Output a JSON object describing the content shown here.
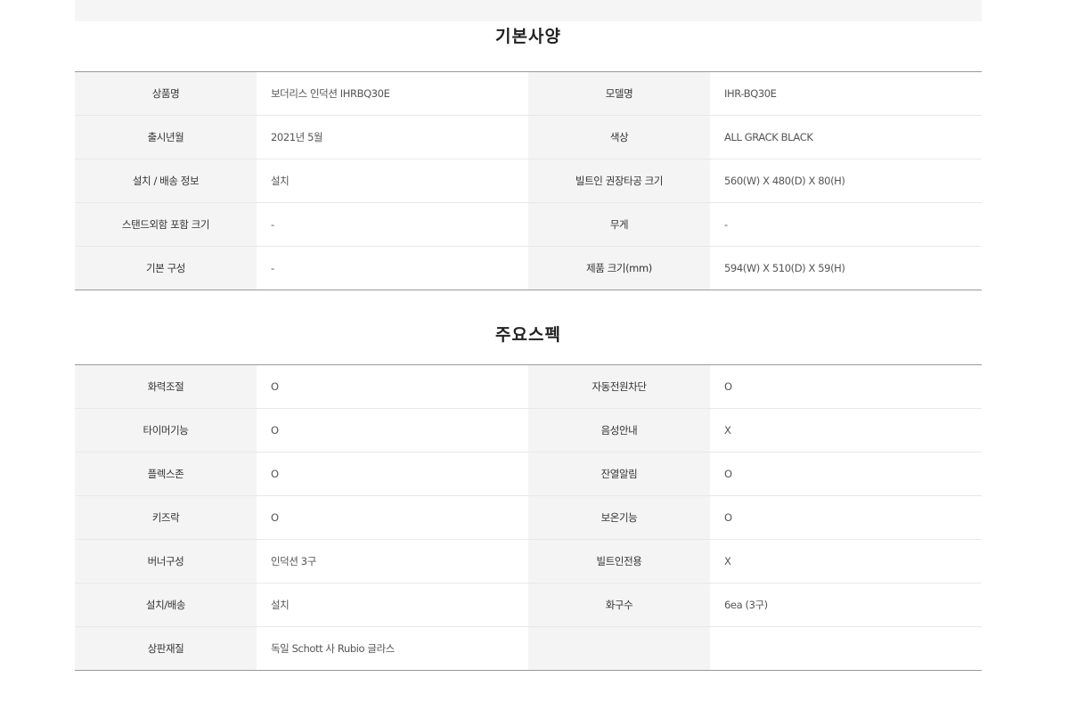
{
  "basic": {
    "title": "기본사양",
    "rows": [
      [
        {
          "label": "상품명",
          "value": "보더리스 인덕션 IHRBQ30E"
        },
        {
          "label": "모델명",
          "value": "IHR-BQ30E"
        }
      ],
      [
        {
          "label": "출시년월",
          "value": "2021년 5월"
        },
        {
          "label": "색상",
          "value": "ALL GRACK BLACK"
        }
      ],
      [
        {
          "label": "설치 / 배송 정보",
          "value": "설치"
        },
        {
          "label": "빌트인 권장타공 크기",
          "value": "560(W) X 480(D) X 80(H)"
        }
      ],
      [
        {
          "label": "스탠드외함 포함 크기",
          "value": "-"
        },
        {
          "label": "무게",
          "value": "-"
        }
      ],
      [
        {
          "label": "기본 구성",
          "value": "-"
        },
        {
          "label": "제품 크기(mm)",
          "value": "594(W) X 510(D) X 59(H)"
        }
      ]
    ]
  },
  "spec": {
    "title": "주요스펙",
    "rows": [
      [
        {
          "label": "화력조절",
          "value": "O"
        },
        {
          "label": "자동전원차단",
          "value": "O"
        }
      ],
      [
        {
          "label": "타이머기능",
          "value": "O"
        },
        {
          "label": "음성안내",
          "value": "X"
        }
      ],
      [
        {
          "label": "플렉스존",
          "value": "O"
        },
        {
          "label": "잔열알림",
          "value": "O"
        }
      ],
      [
        {
          "label": "키즈락",
          "value": "O"
        },
        {
          "label": "보온기능",
          "value": "O"
        }
      ],
      [
        {
          "label": "버너구성",
          "value": "인덕션 3구"
        },
        {
          "label": "빌트인전용",
          "value": "X"
        }
      ],
      [
        {
          "label": "설치/배송",
          "value": "설치"
        },
        {
          "label": "화구수",
          "value": "6ea (3구)"
        }
      ],
      [
        {
          "label": "상판재질",
          "value": "독일 Schott 사 Rubio 글라스"
        },
        {
          "label": "",
          "value": ""
        }
      ]
    ]
  }
}
